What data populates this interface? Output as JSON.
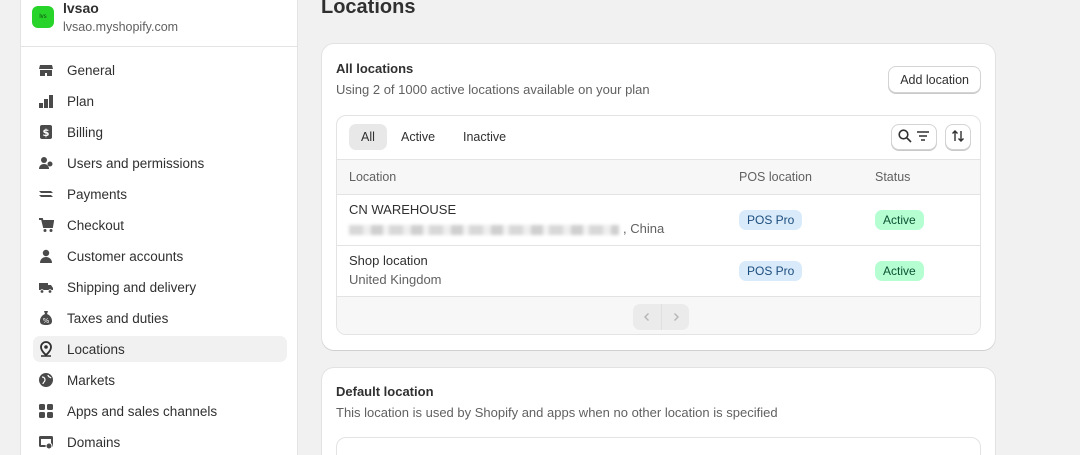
{
  "store": {
    "logo_text": "lvs",
    "name": "lvsao",
    "domain": "lvsao.myshopify.com"
  },
  "sidebar": {
    "items": [
      {
        "label": "General",
        "icon": "store-icon"
      },
      {
        "label": "Plan",
        "icon": "plan-icon"
      },
      {
        "label": "Billing",
        "icon": "billing-icon"
      },
      {
        "label": "Users and permissions",
        "icon": "users-icon"
      },
      {
        "label": "Payments",
        "icon": "payments-icon"
      },
      {
        "label": "Checkout",
        "icon": "cart-icon"
      },
      {
        "label": "Customer accounts",
        "icon": "person-icon"
      },
      {
        "label": "Shipping and delivery",
        "icon": "truck-icon"
      },
      {
        "label": "Taxes and duties",
        "icon": "tax-icon"
      },
      {
        "label": "Locations",
        "icon": "location-icon",
        "active": true
      },
      {
        "label": "Markets",
        "icon": "globe-icon"
      },
      {
        "label": "Apps and sales channels",
        "icon": "apps-icon"
      },
      {
        "label": "Domains",
        "icon": "domain-icon"
      }
    ]
  },
  "page": {
    "title": "Locations"
  },
  "all_locations": {
    "title": "All locations",
    "subtitle": "Using 2 of 1000 active locations available on your plan",
    "add_button": "Add location",
    "tabs": [
      {
        "label": "All",
        "active": true
      },
      {
        "label": "Active",
        "active": false
      },
      {
        "label": "Inactive",
        "active": false
      }
    ],
    "columns": {
      "location": "Location",
      "pos": "POS location",
      "status": "Status"
    },
    "rows": [
      {
        "name": "CN WAREHOUSE",
        "address_visible": "China",
        "address_suffix": ", China",
        "pos": "POS Pro",
        "status": "Active"
      },
      {
        "name": "Shop location",
        "address_visible": "United Kingdom",
        "pos": "POS Pro",
        "status": "Active"
      }
    ]
  },
  "default_location": {
    "title": "Default location",
    "subtitle": "This location is used by Shopify and apps when no other location is specified"
  },
  "colors": {
    "badge_pos_bg": "#d9ebfa",
    "badge_active_bg": "#b4fed2",
    "store_logo": "#28d32a"
  }
}
